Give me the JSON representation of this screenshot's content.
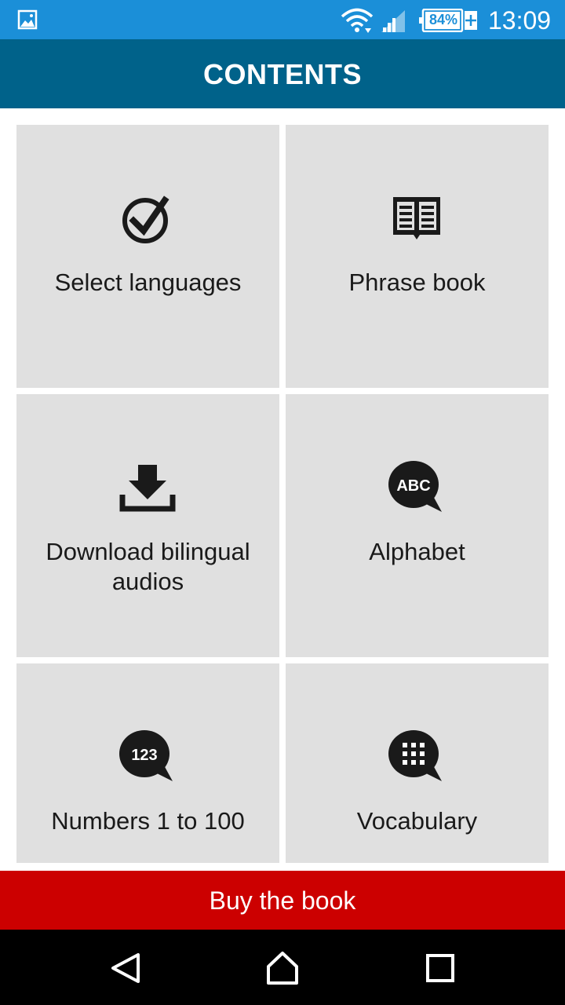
{
  "status_bar": {
    "battery_level": "84%",
    "time": "13:09",
    "icons": [
      "gallery-icon",
      "wifi-icon",
      "signal-icon",
      "battery-charging-icon"
    ]
  },
  "app_bar": {
    "title": "CONTENTS"
  },
  "menu": {
    "items": [
      {
        "label": "Select languages",
        "icon": "check-circle-icon"
      },
      {
        "label": "Phrase book",
        "icon": "book-icon"
      },
      {
        "label": "Download bilingual audios",
        "icon": "download-icon"
      },
      {
        "label": "Alphabet",
        "icon": "abc-speech-bubble-icon",
        "icon_text": "ABC"
      },
      {
        "label": "Numbers 1 to 100",
        "icon": "numbers-speech-bubble-icon",
        "icon_text": "123"
      },
      {
        "label": "Vocabulary",
        "icon": "grid-speech-bubble-icon"
      }
    ]
  },
  "buy_button": {
    "label": "Buy the book"
  },
  "nav_bar": {
    "icons": [
      "back-icon",
      "home-icon",
      "recents-icon"
    ]
  },
  "colors": {
    "status_bar": "#1b8fd8",
    "app_bar": "#00628a",
    "tile_background": "#e0e0e0",
    "buy_button": "#cc0000",
    "nav_bar": "#000000"
  }
}
